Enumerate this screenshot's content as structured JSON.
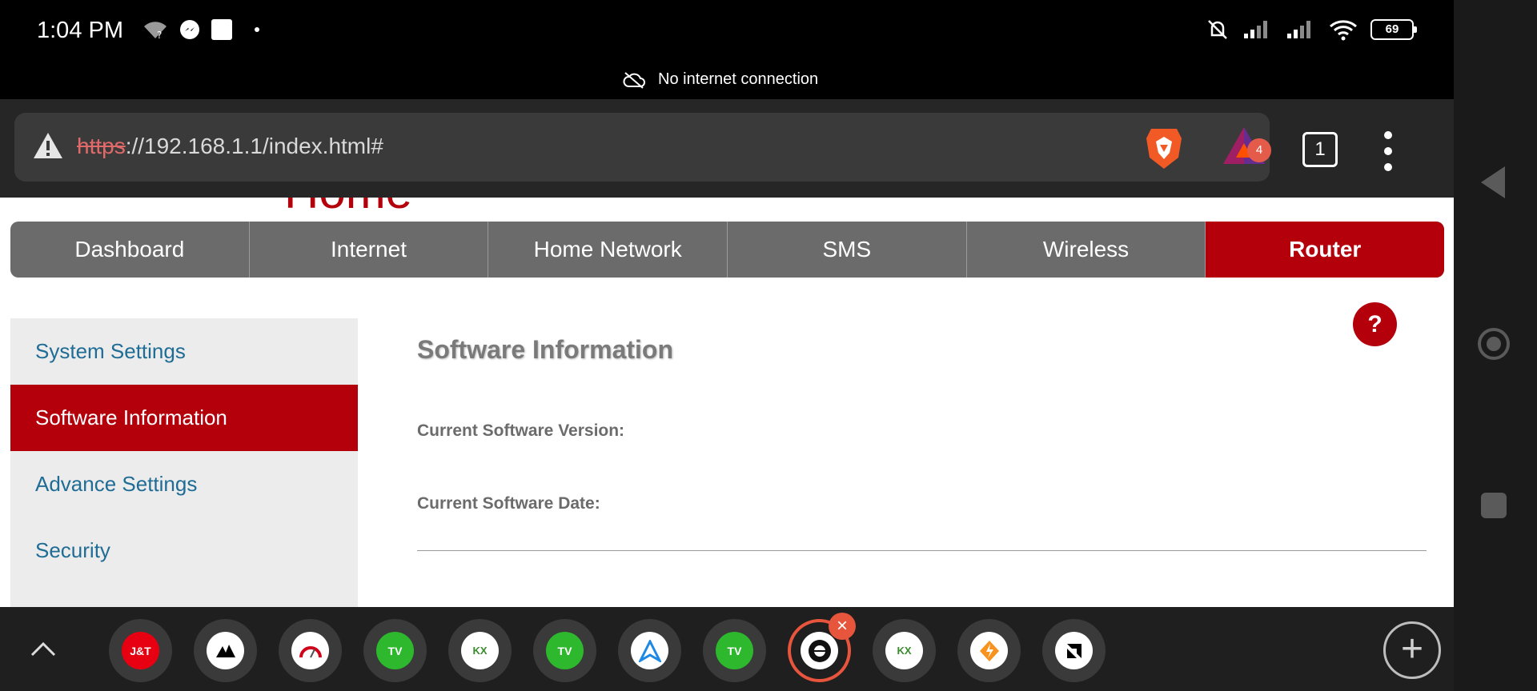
{
  "status_bar": {
    "time": "1:04 PM",
    "battery": "69",
    "icons_left": [
      "wifi-question-icon",
      "messenger-icon",
      "image-icon",
      "dot-icon"
    ],
    "icons_right": [
      "mute-bell-icon",
      "signal-1-icon",
      "signal-2-icon",
      "wifi-icon",
      "battery-icon"
    ]
  },
  "offline_banner": {
    "text": "No internet connection",
    "icon": "cloud-off-icon"
  },
  "browser": {
    "url_scheme": "https",
    "url_rest": "://192.168.1.1/index.html#",
    "rewards_badge": "4",
    "tab_count": "1"
  },
  "page": {
    "logo_text": "Home",
    "nav": [
      "Dashboard",
      "Internet",
      "Home Network",
      "SMS",
      "Wireless",
      "Router"
    ],
    "active_nav": "Router",
    "sidebar": [
      "System Settings",
      "Software Information",
      "Advance Settings",
      "Security"
    ],
    "active_sidebar": "Software Information",
    "help_label": "?",
    "title": "Software Information",
    "fields": {
      "version_label": "Current Software Version:",
      "date_label": "Current Software Date:"
    }
  },
  "taskbar": {
    "apps": [
      "J&T",
      "corsair",
      "speedometer",
      "tv-green",
      "kox",
      "tv-green",
      "arrow-a",
      "tv-green",
      "browser",
      "kox",
      "lightning",
      "amd"
    ],
    "selected_index": 8,
    "close_label": "×",
    "add_label": "+"
  },
  "colors": {
    "brand_red": "#b3000b",
    "link_blue": "#1f6c95",
    "accent_orange": "#e8553d"
  }
}
